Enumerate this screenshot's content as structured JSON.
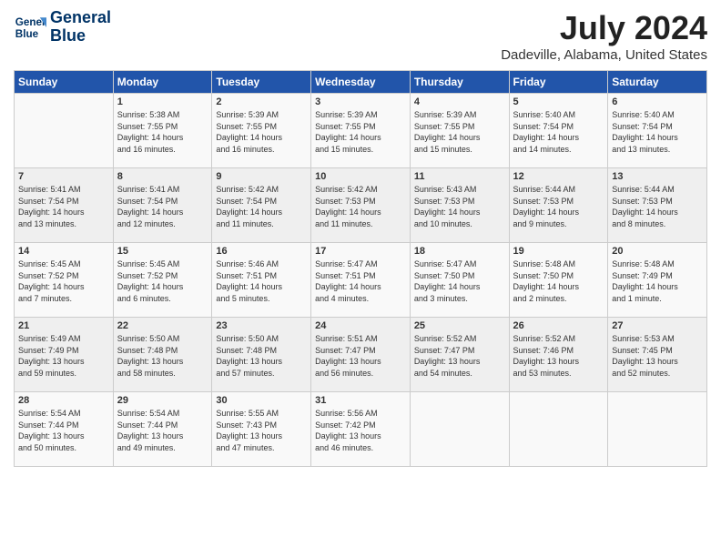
{
  "header": {
    "logo_line1": "General",
    "logo_line2": "Blue",
    "month": "July 2024",
    "location": "Dadeville, Alabama, United States"
  },
  "days_of_week": [
    "Sunday",
    "Monday",
    "Tuesday",
    "Wednesday",
    "Thursday",
    "Friday",
    "Saturday"
  ],
  "weeks": [
    [
      {
        "day": "",
        "info": ""
      },
      {
        "day": "1",
        "info": "Sunrise: 5:38 AM\nSunset: 7:55 PM\nDaylight: 14 hours\nand 16 minutes."
      },
      {
        "day": "2",
        "info": "Sunrise: 5:39 AM\nSunset: 7:55 PM\nDaylight: 14 hours\nand 16 minutes."
      },
      {
        "day": "3",
        "info": "Sunrise: 5:39 AM\nSunset: 7:55 PM\nDaylight: 14 hours\nand 15 minutes."
      },
      {
        "day": "4",
        "info": "Sunrise: 5:39 AM\nSunset: 7:55 PM\nDaylight: 14 hours\nand 15 minutes."
      },
      {
        "day": "5",
        "info": "Sunrise: 5:40 AM\nSunset: 7:54 PM\nDaylight: 14 hours\nand 14 minutes."
      },
      {
        "day": "6",
        "info": "Sunrise: 5:40 AM\nSunset: 7:54 PM\nDaylight: 14 hours\nand 13 minutes."
      }
    ],
    [
      {
        "day": "7",
        "info": "Sunrise: 5:41 AM\nSunset: 7:54 PM\nDaylight: 14 hours\nand 13 minutes."
      },
      {
        "day": "8",
        "info": "Sunrise: 5:41 AM\nSunset: 7:54 PM\nDaylight: 14 hours\nand 12 minutes."
      },
      {
        "day": "9",
        "info": "Sunrise: 5:42 AM\nSunset: 7:54 PM\nDaylight: 14 hours\nand 11 minutes."
      },
      {
        "day": "10",
        "info": "Sunrise: 5:42 AM\nSunset: 7:53 PM\nDaylight: 14 hours\nand 11 minutes."
      },
      {
        "day": "11",
        "info": "Sunrise: 5:43 AM\nSunset: 7:53 PM\nDaylight: 14 hours\nand 10 minutes."
      },
      {
        "day": "12",
        "info": "Sunrise: 5:44 AM\nSunset: 7:53 PM\nDaylight: 14 hours\nand 9 minutes."
      },
      {
        "day": "13",
        "info": "Sunrise: 5:44 AM\nSunset: 7:53 PM\nDaylight: 14 hours\nand 8 minutes."
      }
    ],
    [
      {
        "day": "14",
        "info": "Sunrise: 5:45 AM\nSunset: 7:52 PM\nDaylight: 14 hours\nand 7 minutes."
      },
      {
        "day": "15",
        "info": "Sunrise: 5:45 AM\nSunset: 7:52 PM\nDaylight: 14 hours\nand 6 minutes."
      },
      {
        "day": "16",
        "info": "Sunrise: 5:46 AM\nSunset: 7:51 PM\nDaylight: 14 hours\nand 5 minutes."
      },
      {
        "day": "17",
        "info": "Sunrise: 5:47 AM\nSunset: 7:51 PM\nDaylight: 14 hours\nand 4 minutes."
      },
      {
        "day": "18",
        "info": "Sunrise: 5:47 AM\nSunset: 7:50 PM\nDaylight: 14 hours\nand 3 minutes."
      },
      {
        "day": "19",
        "info": "Sunrise: 5:48 AM\nSunset: 7:50 PM\nDaylight: 14 hours\nand 2 minutes."
      },
      {
        "day": "20",
        "info": "Sunrise: 5:48 AM\nSunset: 7:49 PM\nDaylight: 14 hours\nand 1 minute."
      }
    ],
    [
      {
        "day": "21",
        "info": "Sunrise: 5:49 AM\nSunset: 7:49 PM\nDaylight: 13 hours\nand 59 minutes."
      },
      {
        "day": "22",
        "info": "Sunrise: 5:50 AM\nSunset: 7:48 PM\nDaylight: 13 hours\nand 58 minutes."
      },
      {
        "day": "23",
        "info": "Sunrise: 5:50 AM\nSunset: 7:48 PM\nDaylight: 13 hours\nand 57 minutes."
      },
      {
        "day": "24",
        "info": "Sunrise: 5:51 AM\nSunset: 7:47 PM\nDaylight: 13 hours\nand 56 minutes."
      },
      {
        "day": "25",
        "info": "Sunrise: 5:52 AM\nSunset: 7:47 PM\nDaylight: 13 hours\nand 54 minutes."
      },
      {
        "day": "26",
        "info": "Sunrise: 5:52 AM\nSunset: 7:46 PM\nDaylight: 13 hours\nand 53 minutes."
      },
      {
        "day": "27",
        "info": "Sunrise: 5:53 AM\nSunset: 7:45 PM\nDaylight: 13 hours\nand 52 minutes."
      }
    ],
    [
      {
        "day": "28",
        "info": "Sunrise: 5:54 AM\nSunset: 7:44 PM\nDaylight: 13 hours\nand 50 minutes."
      },
      {
        "day": "29",
        "info": "Sunrise: 5:54 AM\nSunset: 7:44 PM\nDaylight: 13 hours\nand 49 minutes."
      },
      {
        "day": "30",
        "info": "Sunrise: 5:55 AM\nSunset: 7:43 PM\nDaylight: 13 hours\nand 47 minutes."
      },
      {
        "day": "31",
        "info": "Sunrise: 5:56 AM\nSunset: 7:42 PM\nDaylight: 13 hours\nand 46 minutes."
      },
      {
        "day": "",
        "info": ""
      },
      {
        "day": "",
        "info": ""
      },
      {
        "day": "",
        "info": ""
      }
    ]
  ]
}
